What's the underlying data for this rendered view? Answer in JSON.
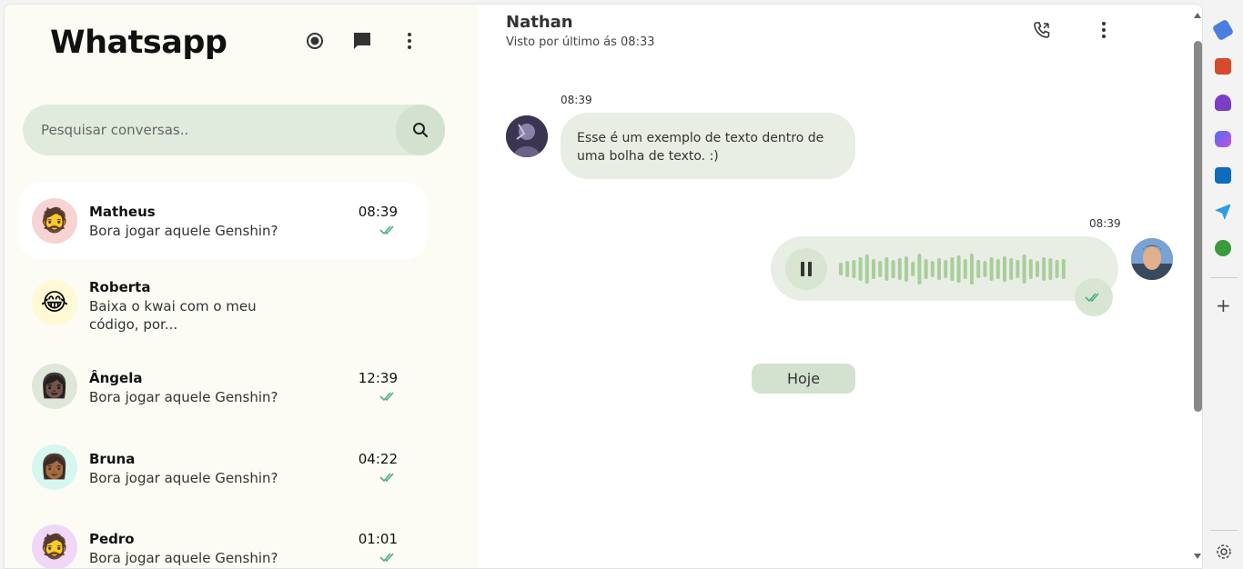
{
  "sidebar": {
    "title": "Whatsapp",
    "header_icons": [
      "status-icon",
      "new-chat-icon",
      "menu-dots-icon"
    ],
    "search_placeholder": "Pesquisar conversas..",
    "chats": [
      {
        "name": "Matheus",
        "message": "Bora jogar aquele Genshin?",
        "time": "08:39",
        "read": true,
        "avatar": "🧔",
        "avatar_bg": "#f8d3d3",
        "active": true
      },
      {
        "name": "Roberta",
        "message": "Baixa o kwai com o meu código, por...",
        "time": "",
        "read": false,
        "avatar": "😂",
        "avatar_bg": "#fff9d6",
        "active": false
      },
      {
        "name": "Ângela",
        "message": "Bora jogar aquele Genshin?",
        "time": "12:39",
        "read": true,
        "avatar": "👩🏿",
        "avatar_bg": "#dfe7da",
        "active": false
      },
      {
        "name": "Bruna",
        "message": "Bora jogar aquele Genshin?",
        "time": "04:22",
        "read": true,
        "avatar": "👩🏾",
        "avatar_bg": "#d5f7ef",
        "active": false
      },
      {
        "name": "Pedro",
        "message": "Bora jogar aquele Genshin?",
        "time": "01:01",
        "read": true,
        "avatar": "🧔",
        "avatar_bg": "#f0d7f7",
        "active": false
      }
    ]
  },
  "conversation": {
    "contact_name": "Nathan",
    "contact_status": "Visto por último ás 08:33",
    "header_icons": [
      "phone-call-icon",
      "menu-dots-icon"
    ],
    "incoming": {
      "time": "08:39",
      "text": "Esse é um exemplo de texto dentro de uma bolha de texto. :)"
    },
    "outgoing_audio": {
      "time": "08:39",
      "state": "paused"
    },
    "date_divider": "Hoje"
  },
  "colors": {
    "accent": "#e1ebdd",
    "accent_dark": "#d3e2cf",
    "tick": "#4caf82",
    "sidebar_bg": "#fcfcf5"
  }
}
